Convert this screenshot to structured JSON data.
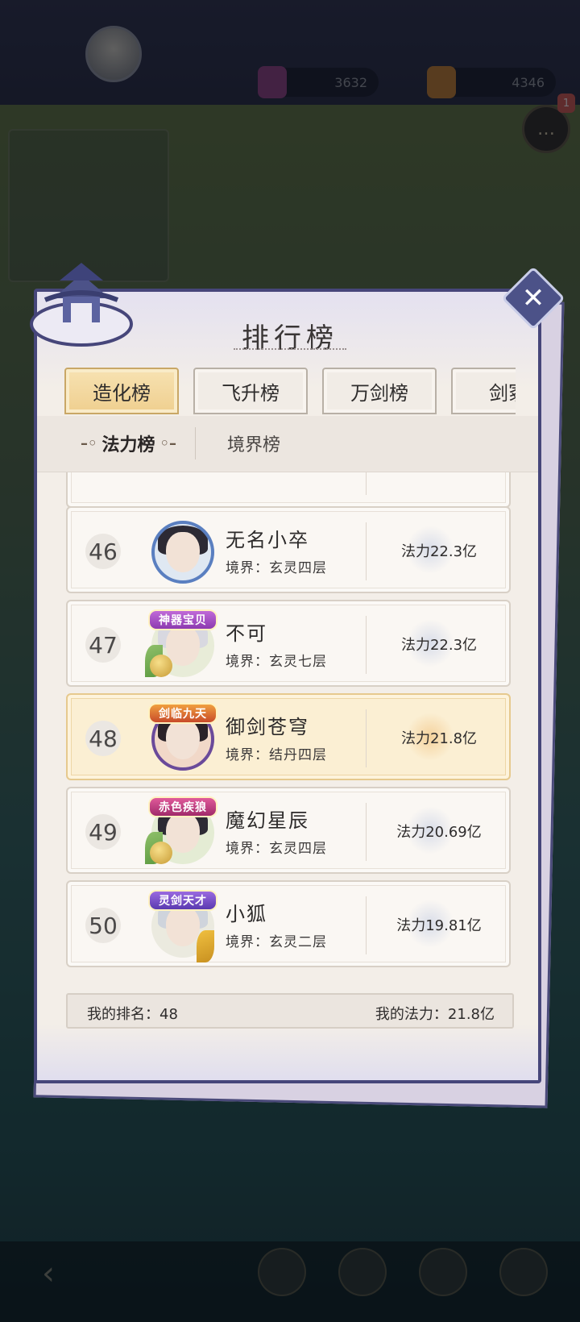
{
  "background": {
    "resources": [
      {
        "icon": "gem-icon",
        "value": "3632"
      },
      {
        "icon": "spirit-stone-icon",
        "value": "4346"
      }
    ],
    "chat_badge": "1"
  },
  "modal": {
    "title": "排行榜",
    "close_icon": "✕",
    "tabs": [
      {
        "label": "造化榜",
        "active": true
      },
      {
        "label": "飞升榜",
        "active": false
      },
      {
        "label": "万剑榜",
        "active": false
      },
      {
        "label": "剑冢",
        "active": false
      }
    ],
    "subtabs": [
      {
        "label": "法力榜",
        "active": true
      },
      {
        "label": "境界榜",
        "active": false
      }
    ],
    "rows": [
      {
        "rank": "46",
        "name": "无名小卒",
        "realm": "境界：玄灵四层",
        "power": "法力22.3亿",
        "badge": "",
        "is_me": false
      },
      {
        "rank": "47",
        "name": "不可",
        "realm": "境界：玄灵七层",
        "power": "法力22.3亿",
        "badge": "神器宝贝",
        "is_me": false
      },
      {
        "rank": "48",
        "name": "御剑苍穹",
        "realm": "境界：结丹四层",
        "power": "法力21.8亿",
        "badge": "剑临九天",
        "is_me": true
      },
      {
        "rank": "49",
        "name": "魔幻星辰",
        "realm": "境界：玄灵四层",
        "power": "法力20.69亿",
        "badge": "赤色疾狼",
        "is_me": false
      },
      {
        "rank": "50",
        "name": "小狐",
        "realm": "境界：玄灵二层",
        "power": "法力19.81亿",
        "badge": "灵剑天才",
        "is_me": false
      }
    ],
    "footer": {
      "my_rank": "我的排名：48",
      "my_power": "我的法力：21.8亿"
    }
  },
  "colors": {
    "frame": "#46467a",
    "active_tab": "#efcf8f",
    "my_row": "#fbefd3"
  }
}
